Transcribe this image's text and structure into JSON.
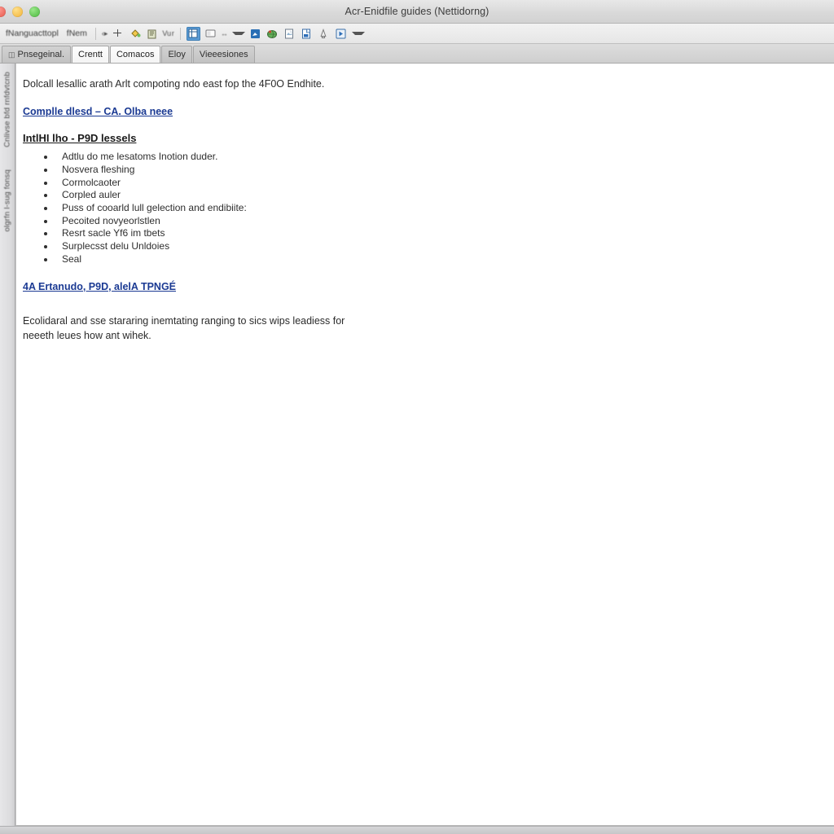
{
  "window": {
    "title": "Acr-Enidfile guides (Nettidorng)",
    "controls": [
      {
        "name": "close",
        "color": "#ec6a5e"
      },
      {
        "name": "minimize",
        "color": "#f5bf4f"
      },
      {
        "name": "zoom",
        "color": "#61c554"
      }
    ]
  },
  "toolbar": {
    "menu_labels": [
      "fNanguacttopl",
      "fNem"
    ],
    "items": [
      {
        "icon": "undo-redo-icon",
        "label": "«»"
      },
      {
        "icon": "add-plus-icon",
        "label": ""
      },
      {
        "icon": "paint-bucket-icon",
        "label": ""
      },
      {
        "icon": "book-icon",
        "label": ""
      },
      {
        "icon": "text-wrap-icon",
        "label": "Vu r"
      },
      {
        "icon": "table-icon",
        "label": ""
      },
      {
        "icon": "frame-icon",
        "label": ""
      },
      {
        "icon": "arrows-icon",
        "label": ""
      },
      {
        "icon": "blue-square-icon",
        "label": ""
      },
      {
        "icon": "globe-icon",
        "label": ""
      },
      {
        "icon": "image-export-icon",
        "label": ""
      },
      {
        "icon": "page-blue-icon",
        "label": ""
      },
      {
        "icon": "bookmark-icon",
        "label": ""
      },
      {
        "icon": "media-icon",
        "label": ""
      }
    ],
    "overflow_label": "chevron-down-icon"
  },
  "tabs": [
    {
      "label": "Pnsegeinal.",
      "icon": "file-icon",
      "active": false
    },
    {
      "label": "Crentt",
      "active": true
    },
    {
      "label": "Comacos",
      "active": true
    },
    {
      "label": "Eloy",
      "active": false
    },
    {
      "label": "Vieeesiones",
      "active": false
    }
  ],
  "sidebar": {
    "vertical_labels": [
      "Cnlivse bfd rnfdvtcnb",
      "olgrfn l-sug fonsq"
    ]
  },
  "document": {
    "intro": "Dolcall lesallic arath Arlt compoting ndo east fop the 4F0O Endhite.",
    "link_primary": "Complle dlesd – CA. Olba neee",
    "heading": "IntlHI lho - P9D lessels",
    "bullets": [
      "Adtlu do me lesatoms Inotion duder.",
      "Nosvera fleshing",
      "Cormolcaoter",
      "Corpled auler",
      "Puss of cooarld lull gelection and endibiite:",
      "Pecoited novyeorlstlen",
      "Resrt sacle Yf6 im tbets",
      "Surplecsst delu Unldoies",
      "Seal"
    ],
    "link_secondary": "4A Ertanudo, P9D, alelA TPNGÉ",
    "closing": "Ecolidaral and sse stararing inemtating ranging to sics wips leadiess for neeeth leues how ant wihek."
  },
  "colors": {
    "link": "#1b3a93",
    "accent": "#5a9bd5",
    "chrome": "#e4e4e6"
  }
}
